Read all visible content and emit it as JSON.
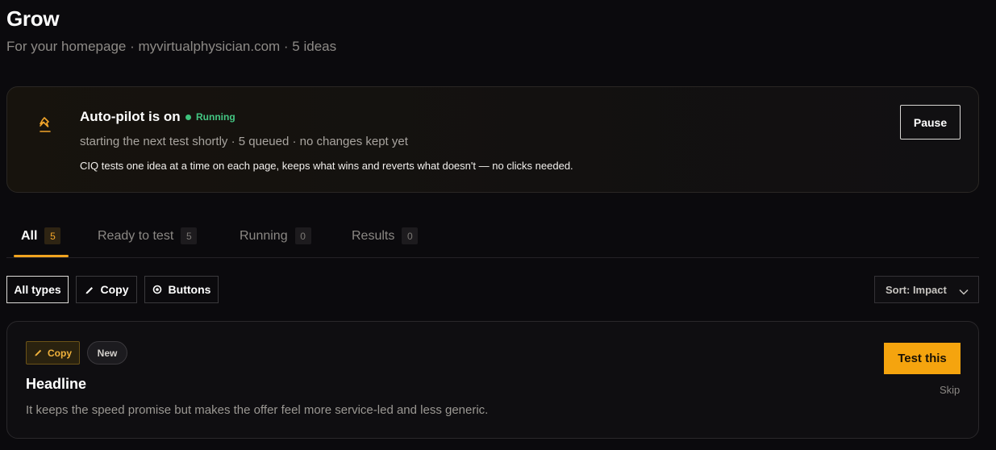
{
  "page": {
    "title": "Grow",
    "subtitle": "For your homepage · myvirtualphysician.com · 5 ideas"
  },
  "autopilot": {
    "title": "Auto-pilot is on",
    "status": "Running",
    "status_color": "#44c683",
    "summary": "starting the next test shortly · 5 queued · no changes kept yet",
    "description": "CIQ tests one idea at a time on each page, keeps what wins and reverts what doesn't — no clicks needed.",
    "pause_label": "Pause",
    "icon": "pin-icon"
  },
  "tabs": [
    {
      "label": "All",
      "count": "5",
      "active": true
    },
    {
      "label": "Ready to test",
      "count": "5",
      "active": false
    },
    {
      "label": "Running",
      "count": "0",
      "active": false
    },
    {
      "label": "Results",
      "count": "0",
      "active": false
    }
  ],
  "filters": [
    {
      "label": "All types",
      "selected": true,
      "icon": ""
    },
    {
      "label": "Copy",
      "selected": false,
      "icon": "pencil-icon"
    },
    {
      "label": "Buttons",
      "selected": false,
      "icon": "cursor-click-icon"
    }
  ],
  "sort": {
    "label": "Sort: Impact"
  },
  "ideas": [
    {
      "type_label": "Copy",
      "type_icon": "pencil-icon",
      "badge": "New",
      "title": "Headline",
      "description": "It keeps the speed promise but makes the offer feel more service-led and less generic.",
      "test_label": "Test this",
      "skip_label": "Skip"
    }
  ],
  "colors": {
    "accent": "#f5a40e",
    "background": "#0b0a0d"
  }
}
